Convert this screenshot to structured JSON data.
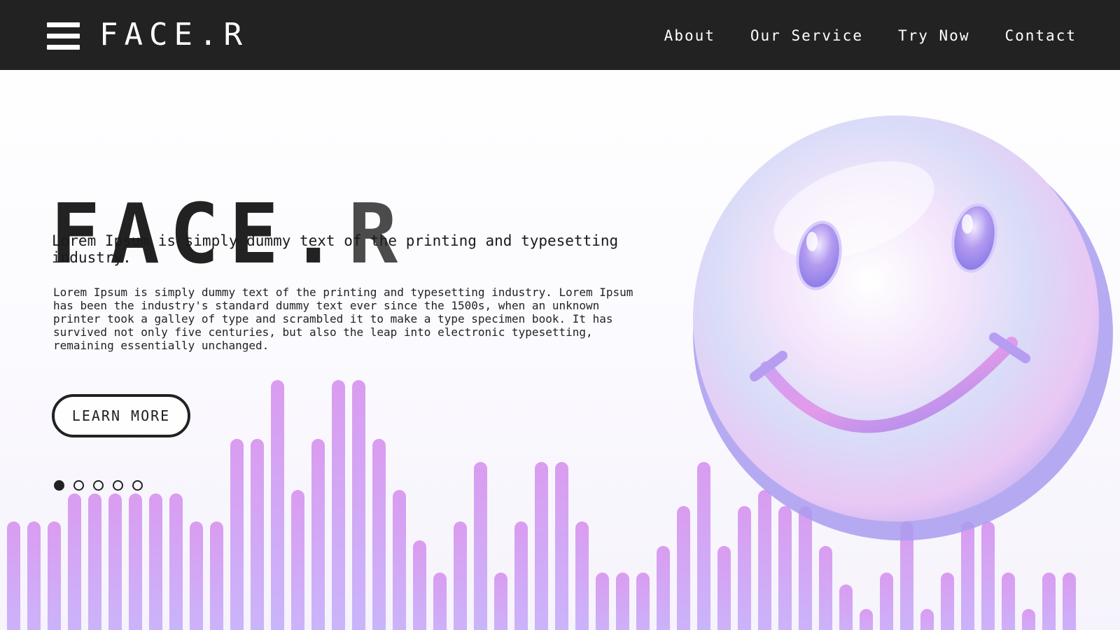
{
  "header": {
    "brand": "FACE.R",
    "nav": [
      "About",
      "Our Service",
      "Try Now",
      "Contact"
    ]
  },
  "hero": {
    "title": "FACE.",
    "title_last": "R",
    "subtitle": "Lorem Ipsum is simply dummy text of the printing and typesetting industry.",
    "description": "Lorem Ipsum is simply dummy text of the printing and typesetting industry. Lorem Ipsum has been the industry's standard dummy text ever since the 1500s, when an unknown printer took a galley of type and scrambled it to make a type specimen book. It has survived not only five centuries, but also the leap into electronic typesetting, remaining essentially unchanged.",
    "cta_label": "LEARN MORE"
  },
  "carousel": {
    "count": 5,
    "active_index": 0
  },
  "colors": {
    "header_bg": "#222222",
    "text": "#1f1f1f",
    "bar_top": "#d99cf0",
    "bar_bottom": "#c9b5fb"
  },
  "icons": {
    "menu": "hamburger-icon",
    "hero_art": "smiley-face-icon"
  }
}
